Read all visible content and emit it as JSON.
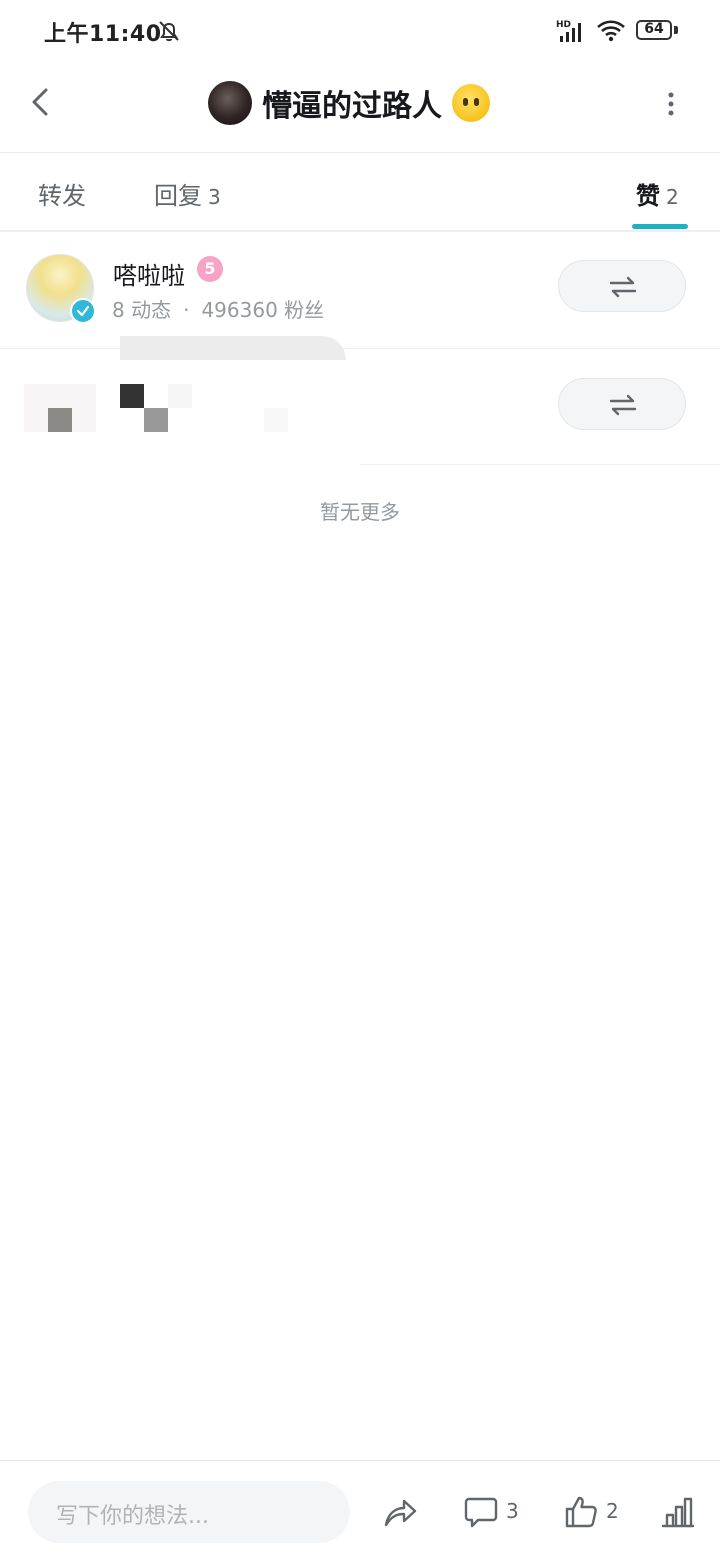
{
  "status_bar": {
    "time": "上午11:40",
    "battery": "64",
    "network": "HD"
  },
  "header": {
    "title": "懵逼的过路人"
  },
  "tabs": [
    {
      "label": "转发",
      "count": ""
    },
    {
      "label": "回复",
      "count": "3"
    },
    {
      "label": "赞",
      "count": "2"
    }
  ],
  "accent_color": "#1eb1c4",
  "likers": [
    {
      "name": "嗒啦啦",
      "level": "5",
      "posts": "8 动态",
      "separator": "·",
      "fans": "496360 粉丝",
      "verified": true
    }
  ],
  "list_end_text": "暂无更多",
  "bottom_bar": {
    "input_placeholder": "写下你的想法...",
    "comment_count": "3",
    "like_count": "2"
  }
}
